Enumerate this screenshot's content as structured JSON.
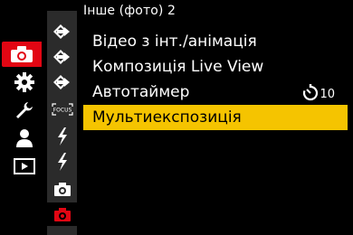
{
  "header": {
    "title": "Інше (фото) 2"
  },
  "colors": {
    "accent_red": "#e20613",
    "highlight_yellow": "#f5c400",
    "subtab_bg": "#2b2b2b"
  },
  "main_tabs": [
    {
      "icon": "camera-icon",
      "active": true
    },
    {
      "icon": "gear-icon",
      "active": false
    },
    {
      "icon": "wrench-icon",
      "active": false
    },
    {
      "icon": "person-icon",
      "active": false
    },
    {
      "icon": "playback-icon",
      "active": false
    }
  ],
  "sub_tabs": [
    {
      "icon": "diamond-arrow-icon"
    },
    {
      "icon": "diamond-arrow-icon"
    },
    {
      "icon": "diamond-arrow-icon"
    },
    {
      "icon": "focus-icon",
      "label": "FOCUS"
    },
    {
      "icon": "flash-icon"
    },
    {
      "icon": "flash-icon"
    },
    {
      "icon": "camera-small-icon"
    },
    {
      "icon": "camera-small-icon",
      "active": true
    }
  ],
  "menu": {
    "items": [
      {
        "label": "Відео з інт./анімація"
      },
      {
        "label": "Композиція Live View"
      },
      {
        "label": "Автотаймер",
        "value": "10",
        "value_icon": "self-timer-icon"
      },
      {
        "label": "Мультиекспозиція",
        "selected": true
      }
    ]
  }
}
